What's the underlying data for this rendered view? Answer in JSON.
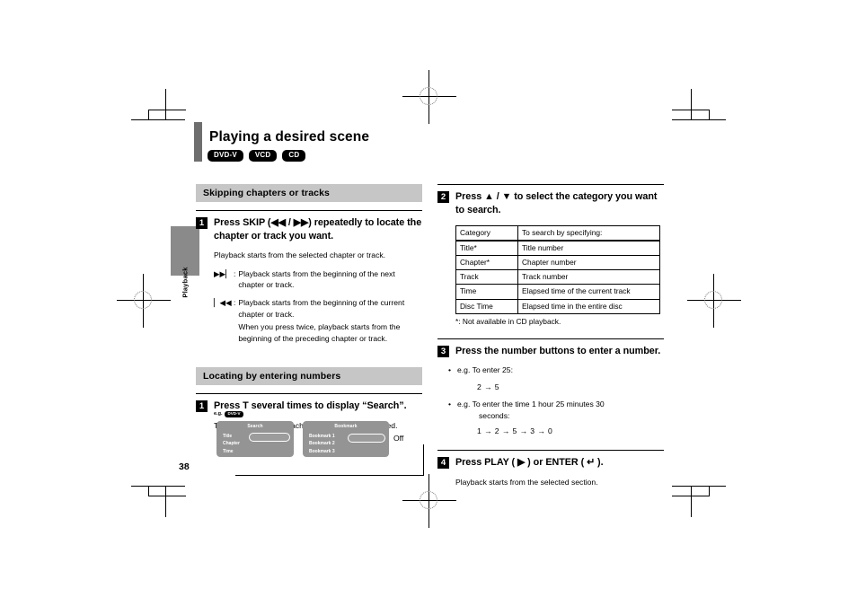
{
  "document": {
    "page_number": "38",
    "side_tab": "Playback",
    "title": "Playing a desired scene",
    "disc_badges": [
      "DVD-V",
      "VCD",
      "CD"
    ]
  },
  "left_column": {
    "section1": {
      "heading": "Skipping chapters or tracks",
      "step": {
        "number": "1",
        "title": "Press SKIP (◀◀ / ▶▶) repeatedly to locate the chapter or track you want.",
        "body": "Playback starts from the selected chapter or track.",
        "symbols": [
          {
            "key": "▶▶▏ :",
            "text": "Playback starts from the beginning of the next chapter or track.",
            "extra": ""
          },
          {
            "key": "▏◀◀ :",
            "text": "Playback starts from the beginning of the current chapter or track.",
            "extra": "When you press twice, playback starts from the beginning of the preceding chapter or track."
          }
        ]
      }
    },
    "section2": {
      "heading": "Locating by entering numbers",
      "step": {
        "number": "1",
        "title": "Press T several times to display “Search”.",
        "body": "The display changes each time this button is pressed."
      },
      "diagram": {
        "eg_label": "e.g.",
        "eg_badge": "DVD-V",
        "panel_search": {
          "title": "Search",
          "rows": [
            "Title",
            "Chapter",
            "Time"
          ]
        },
        "panel_bookmark": {
          "title": "Bookmark",
          "rows": [
            "Bookmark 1",
            "Bookmark 2",
            "Bookmark 3"
          ]
        },
        "off_label": "Off"
      }
    }
  },
  "right_column": {
    "step2": {
      "number": "2",
      "title": "Press ▲ / ▼ to select the category you want to search.",
      "table": {
        "headers": [
          "Category",
          "To search by specifying:"
        ],
        "rows": [
          [
            "Title*",
            "Title number"
          ],
          [
            "Chapter*",
            "Chapter number"
          ],
          [
            "Track",
            "Track number"
          ],
          [
            "Time",
            "Elapsed time of the current track"
          ],
          [
            "Disc Time",
            "Elapsed time in the entire disc"
          ]
        ]
      },
      "note": "*: Not available in CD playback."
    },
    "step3": {
      "number": "3",
      "title": "Press the number buttons to enter a number.",
      "bullet1": "e.g. To enter 25:",
      "example1": "2 → 5",
      "bullet2": "e.g. To enter the time 1 hour 25 minutes 30",
      "bullet2_cont": "seconds:",
      "example2": "1 → 2 → 5 → 3 → 0"
    },
    "step4": {
      "number": "4",
      "title": "Press PLAY ( ▶ ) or ENTER ( ↵ ).",
      "body": "Playback starts from the selected section."
    }
  }
}
